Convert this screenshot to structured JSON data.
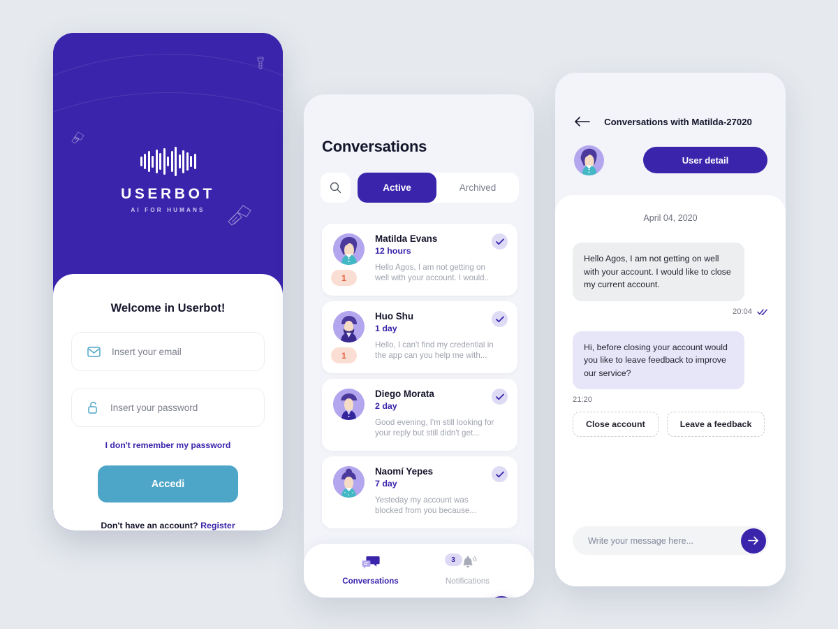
{
  "login": {
    "brand_name": "USERBOT",
    "brand_tagline": "AI FOR HUMANS",
    "title": "Welcome in Userbot!",
    "email_placeholder": "Insert your email",
    "password_placeholder": "Insert your password",
    "forgot_label": "I don't remember my password",
    "submit_label": "Accedi",
    "register_prompt": "Don't have an account? ",
    "register_link": "Register",
    "colors": {
      "hero": "#3a24ab",
      "submit": "#4da5c7",
      "link": "#3a24ab"
    }
  },
  "conversations": {
    "title": "Conversations",
    "search_icon": "search-icon",
    "tabs": [
      {
        "label": "Active",
        "active": true
      },
      {
        "label": "Archived",
        "active": false
      }
    ],
    "items": [
      {
        "name": "Matilda Evans",
        "time": "12 hours",
        "preview": "Hello Agos, I am not getting on well with your account. I would..",
        "unread": "1",
        "read_check": "check-icon"
      },
      {
        "name": "Huo Shu",
        "time": "1 day",
        "preview": "Hello, I can't find my credential in the app can you help me with...",
        "unread": "1",
        "read_check": "check-icon"
      },
      {
        "name": "Diego Morata",
        "time": "2 day",
        "preview": "Good evening, I'm still looking for your reply but still didn't get...",
        "unread": "",
        "read_check": "check-icon"
      },
      {
        "name": "Naomí Yepes",
        "time": "7 day",
        "preview": "Yesteday my account was blocked from you because...",
        "unread": "",
        "read_check": "check-icon"
      }
    ],
    "filter_fab_icon": "sliders-icon",
    "bottom_nav": [
      {
        "label": "Conversations",
        "icon": "chat-bubbles-icon",
        "active": true,
        "badge": ""
      },
      {
        "label": "Notifications",
        "icon": "bell-icon",
        "active": false,
        "badge": "3"
      }
    ]
  },
  "chat": {
    "back_icon": "arrow-left-icon",
    "header_title": "Conversations with Matilda-27020",
    "user_detail_label": "User detail",
    "date_divider": "April 04, 2020",
    "messages": [
      {
        "from": "user",
        "text": "Hello Agos, I am not getting on well with your account. I would like to close my current account.",
        "time": "20:04",
        "status_icon": "double-check-icon"
      },
      {
        "from": "bot",
        "text": "Hi, before closing your account would you like to leave feedback to improve our service?",
        "time": "21:20",
        "status_icon": ""
      }
    ],
    "quick_replies": [
      "Close account",
      "Leave a feedback"
    ],
    "composer_placeholder": "Write your message here...",
    "send_icon": "arrow-right-icon"
  }
}
